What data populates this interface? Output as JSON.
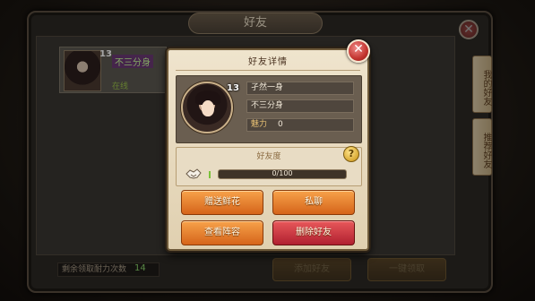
{
  "background": {
    "title": "好友",
    "friend_card": {
      "level": "13",
      "name": "不三分身",
      "status": "在线"
    },
    "side_tabs": [
      "我的好友",
      "推荐好友"
    ],
    "bottom_label": "剩余领取耐力次数",
    "bottom_count": "14",
    "buttons": {
      "add": "添加好友",
      "claim_all": "一键领取"
    }
  },
  "dialog": {
    "title": "好友详情",
    "level": "13",
    "name": "孑然一身",
    "nickname": "不三分身",
    "charm_label": "魅力",
    "charm_value": "0",
    "favor_title": "好友度",
    "favor_text": "0/100",
    "favor_progress": 0.0,
    "help_icon": "?",
    "actions": {
      "gift": "赠送鲜花",
      "chat": "私聊",
      "view": "查看阵容",
      "delete": "删除好友"
    }
  },
  "colors": {
    "accent_orange": "#e37a2a",
    "accent_red": "#c83040",
    "favor_green": "#7ac23a"
  },
  "icons": {
    "close": "close-icon",
    "help": "help-icon",
    "favor": "handshake-icon"
  }
}
